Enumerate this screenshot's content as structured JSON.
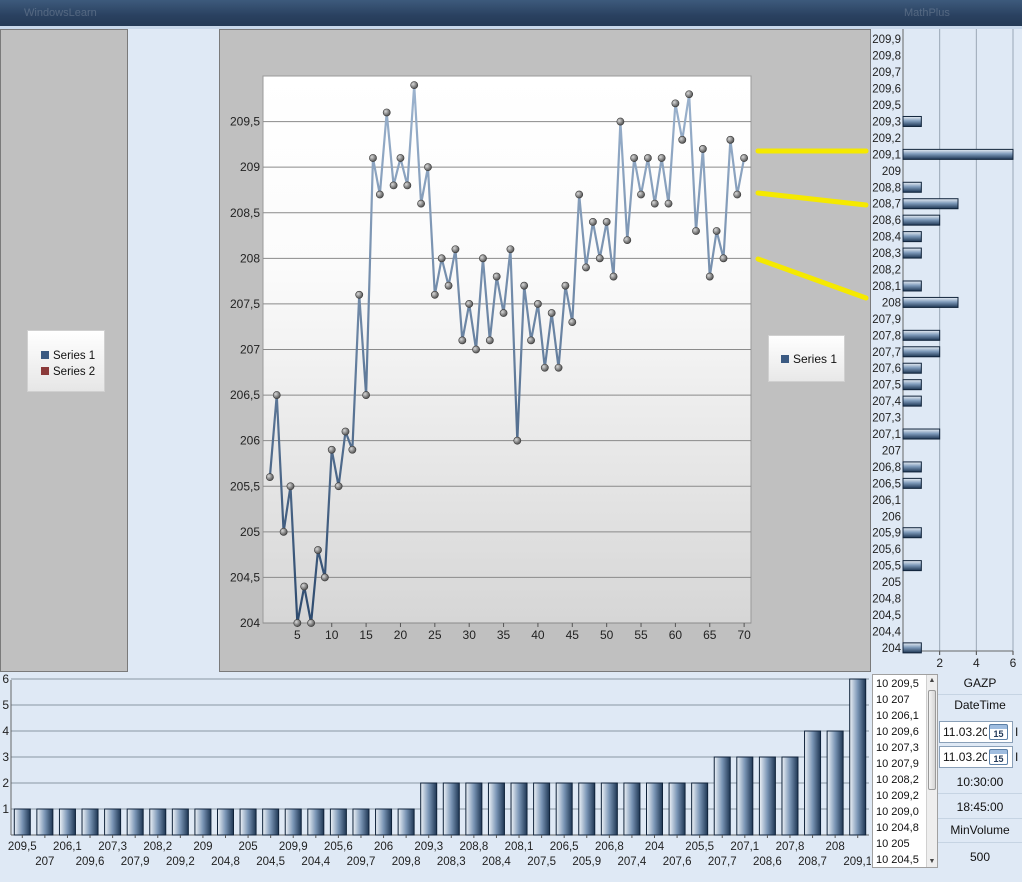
{
  "window": {
    "title": "WindowsLearn",
    "right_title": "MathPlus"
  },
  "left_legend": {
    "series": [
      {
        "name": "Series 1",
        "color": "#3b5a82"
      },
      {
        "name": "Series 2",
        "color": "#8b3a3a"
      }
    ]
  },
  "main_legend": {
    "series": [
      {
        "name": "Series 1",
        "color": "#3b5a82"
      }
    ]
  },
  "highlight_color": "#f5e900",
  "right_panel": {
    "ticker": "GAZP",
    "datetime_label": "DateTime",
    "date_from": "11.03.20",
    "date_to": "11.03.20",
    "calendar_icon_text": "15",
    "time_from": "10:30:00",
    "time_to": "18:45:00",
    "min_volume_label": "MinVolume",
    "min_volume_value": "500",
    "edge_char": "I"
  },
  "listbox": {
    "items": [
      "10 209,5",
      "10 207",
      "10 206,1",
      "10 209,6",
      "10 207,3",
      "10 207,9",
      "10 208,2",
      "10 209,2",
      "10 209,0",
      "10 204,8",
      "10 205",
      "10 204,5"
    ]
  },
  "chart_data": [
    {
      "type": "line",
      "series": [
        {
          "name": "Series 1",
          "x": [
            1,
            2,
            3,
            4,
            5,
            6,
            7,
            8,
            9,
            10,
            11,
            12,
            13,
            14,
            15,
            16,
            17,
            18,
            19,
            20,
            21,
            22,
            23,
            24,
            25,
            26,
            27,
            28,
            29,
            30,
            31,
            32,
            33,
            34,
            35,
            36,
            37,
            38,
            39,
            40,
            41,
            42,
            43,
            44,
            45,
            46,
            47,
            48,
            49,
            50,
            51,
            52,
            53,
            54,
            55,
            56,
            57,
            58,
            59,
            60,
            61,
            62,
            63,
            64,
            65,
            66,
            67,
            68,
            69,
            70
          ],
          "values": [
            205.6,
            206.5,
            205,
            205.5,
            204,
            204.4,
            204,
            204.8,
            204.5,
            205.9,
            205.5,
            206.1,
            205.9,
            207.6,
            206.5,
            209.1,
            208.7,
            209.6,
            208.8,
            209.1,
            208.8,
            209.9,
            208.6,
            209,
            207.6,
            208,
            207.7,
            208.1,
            207.1,
            207.5,
            207,
            208,
            207.1,
            207.8,
            207.4,
            208.1,
            206,
            207.7,
            207.1,
            207.5,
            206.8,
            207.4,
            206.8,
            207.7,
            207.3,
            208.7,
            207.9,
            208.4,
            208,
            208.4,
            207.8,
            209.5,
            208.2,
            209.1,
            208.7,
            209.1,
            208.6,
            209.1,
            208.6,
            209.7,
            209.3,
            209.8,
            208.3,
            209.2,
            207.8,
            208.3,
            208,
            209.3,
            208.7,
            209.1
          ]
        }
      ],
      "ylim": [
        204,
        210
      ],
      "xlim": [
        0,
        71
      ],
      "yticks": [
        "204",
        "204,5",
        "205",
        "205,5",
        "206",
        "206,5",
        "207",
        "207,5",
        "208",
        "208,5",
        "209",
        "209,5"
      ],
      "ytick_values": [
        204,
        204.5,
        205,
        205.5,
        206,
        206.5,
        207,
        207.5,
        208,
        208.5,
        209,
        209.5
      ],
      "xticks": [
        5,
        10,
        15,
        20,
        25,
        30,
        35,
        40,
        45,
        50,
        55,
        60,
        65,
        70
      ],
      "grid": true,
      "legend": "right"
    },
    {
      "type": "bar",
      "orientation": "horizontal",
      "categories": [
        "209,9",
        "209,8",
        "209,7",
        "209,6",
        "209,5",
        "209,3",
        "209,2",
        "209,1",
        "209",
        "208,8",
        "208,7",
        "208,6",
        "208,4",
        "208,3",
        "208,2",
        "208,1",
        "208",
        "207,9",
        "207,8",
        "207,7",
        "207,6",
        "207,5",
        "207,4",
        "207,3",
        "207,1",
        "207",
        "206,8",
        "206,5",
        "206,1",
        "206",
        "205,9",
        "205,6",
        "205,5",
        "205",
        "204,8",
        "204,5",
        "204,4",
        "204"
      ],
      "values": [
        0,
        0,
        0,
        0,
        0,
        1,
        0,
        6,
        0,
        1,
        3,
        2,
        1,
        1,
        0,
        1,
        3,
        0,
        2,
        2,
        1,
        1,
        1,
        0,
        2,
        0,
        1,
        1,
        0,
        0,
        1,
        0,
        1,
        0,
        0,
        0,
        0,
        1
      ],
      "xticks": [
        2,
        4,
        6
      ],
      "xlim": [
        0,
        6
      ],
      "grid": true
    },
    {
      "type": "bar",
      "categories": [
        "209,5",
        "207",
        "206,1",
        "209,6",
        "207,3",
        "207,9",
        "208,2",
        "209,2",
        "209",
        "204,8",
        "205",
        "204,5",
        "209,9",
        "204,4",
        "205,6",
        "209,7",
        "206",
        "209,8",
        "209,3",
        "208,3",
        "208,8",
        "208,4",
        "208,1",
        "207,5",
        "206,5",
        "205,9",
        "206,8",
        "207,4",
        "204",
        "207,6",
        "205,5",
        "207,7",
        "207,1",
        "208,6",
        "207,8",
        "208,7",
        "208",
        "209,1"
      ],
      "values": [
        1,
        1,
        1,
        1,
        1,
        1,
        1,
        1,
        1,
        1,
        1,
        1,
        1,
        1,
        1,
        1,
        1,
        1,
        2,
        2,
        2,
        2,
        2,
        2,
        2,
        2,
        2,
        2,
        2,
        2,
        2,
        3,
        3,
        3,
        3,
        4,
        4,
        6
      ],
      "ylim": [
        0,
        6
      ],
      "yticks": [
        1,
        2,
        3,
        4,
        5,
        6
      ],
      "grid": true
    }
  ]
}
